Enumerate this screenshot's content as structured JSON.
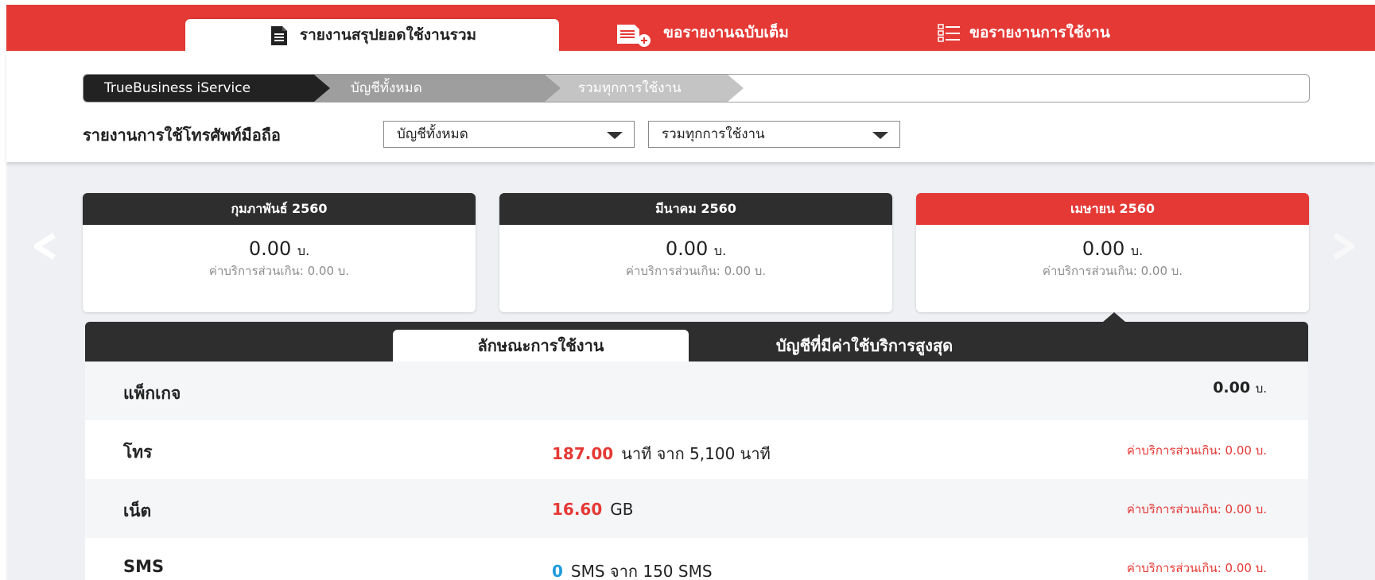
{
  "tabs": [
    {
      "label": "รายงานสรุปยอดใช้งานรวม",
      "icon": "document-icon",
      "active": true
    },
    {
      "label": "ขอรายงานฉบับเต็ม",
      "icon": "document-add-icon",
      "active": false
    },
    {
      "label": "ขอรายงานการใช้งาน",
      "icon": "list-icon",
      "active": false
    }
  ],
  "breadcrumb": [
    "TrueBusiness iService",
    "บัญชีทั้งหมด",
    "รวมทุกการใช้งาน"
  ],
  "filters": {
    "label": "รายงานการใช้โทรศัพท์มือถือ",
    "account": "บัญชีทั้งหมด",
    "usage": "รวมทุกการใช้งาน"
  },
  "months": [
    {
      "title": "กุมภาพันธ์ 2560",
      "amount": "0.00",
      "unit": "บ.",
      "overage": "ค่าบริการส่วนเกิน: 0.00 บ."
    },
    {
      "title": "มีนาคม 2560",
      "amount": "0.00",
      "unit": "บ.",
      "overage": "ค่าบริการส่วนเกิน: 0.00 บ."
    },
    {
      "title": "เมษายน 2560",
      "amount": "0.00",
      "unit": "บ.",
      "overage": "ค่าบริการส่วนเกิน: 0.00 บ.",
      "selected": true
    }
  ],
  "detail_tabs": [
    "ลักษณะการใช้งาน",
    "บัญชีที่มีค่าใช้บริการสูงสุด"
  ],
  "rows": [
    {
      "name": "แพ็กเกจ",
      "amount": "0.00",
      "unit": "บ."
    },
    {
      "name": "โทร",
      "value": "187.00",
      "detail": "นาที จาก 5,100 นาที",
      "overage": "ค่าบริการส่วนเกิน: 0.00  บ."
    },
    {
      "name": "เน็ต",
      "value": "16.60",
      "detail": "GB",
      "overage": "ค่าบริการส่วนเกิน: 0.00  บ."
    },
    {
      "name": "SMS",
      "value": "0",
      "detail": "SMS จาก 150 SMS",
      "overage": "ค่าบริการส่วนเกิน: 0.00  บ."
    }
  ],
  "colors": {
    "brand_red": "#e53935",
    "dark": "#2e2e2e",
    "sms_blue": "#1e9be0"
  }
}
